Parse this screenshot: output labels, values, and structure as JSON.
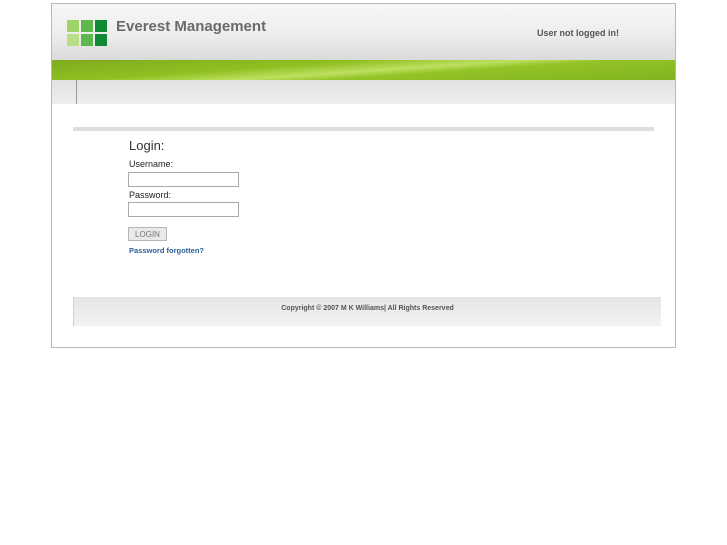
{
  "header": {
    "title": "Everest Management",
    "login_status": "User not logged in!"
  },
  "logo": {
    "colors": [
      "#9fd46a",
      "#5eb74a",
      "#118a35",
      "#b7de89",
      "#5eb74a",
      "#118a35"
    ]
  },
  "login": {
    "heading": "Login:",
    "username_label": "Username:",
    "username_value": "",
    "password_label": "Password:",
    "password_value": "",
    "button_label": "LOGIN",
    "forgot_link": "Password forgotten?"
  },
  "footer": {
    "copyright": "Copyright © 2007 M K Williams| All Rights Reserved"
  },
  "colors": {
    "accent_green": "#8fc021",
    "link_blue": "#2d5f99"
  }
}
